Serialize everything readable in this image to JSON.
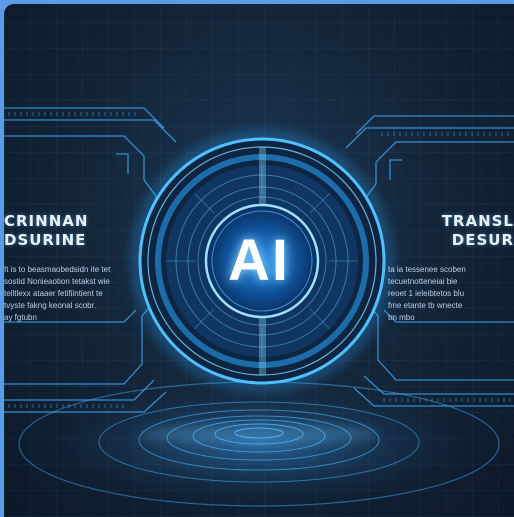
{
  "center": {
    "label": "AI"
  },
  "left_panel": {
    "heading_line1": "CRINNAN",
    "heading_line2": "DSURINE",
    "body_lines": [
      "It is to beasmaobedsidn ite tet",
      "sostid Nonieaotion tetakst wie",
      "telltlexx ataaer fetifiintient te",
      "tvyste fakng keonal scobr.",
      "ay fgtubn"
    ]
  },
  "right_panel": {
    "heading_line1": "TRANSL",
    "heading_line2": "DESUR",
    "body_lines": [
      "ta ia tessenee scoben",
      "tecuetnotteneiai bie",
      "reoet 1 ieleibtetos blu",
      "fme etante tb wnecte",
      "tm mbo"
    ]
  },
  "colors": {
    "accent": "#2aa8ff",
    "glow": "#7fd4ff",
    "background": "#14263b",
    "frame": "#5b9be8"
  }
}
